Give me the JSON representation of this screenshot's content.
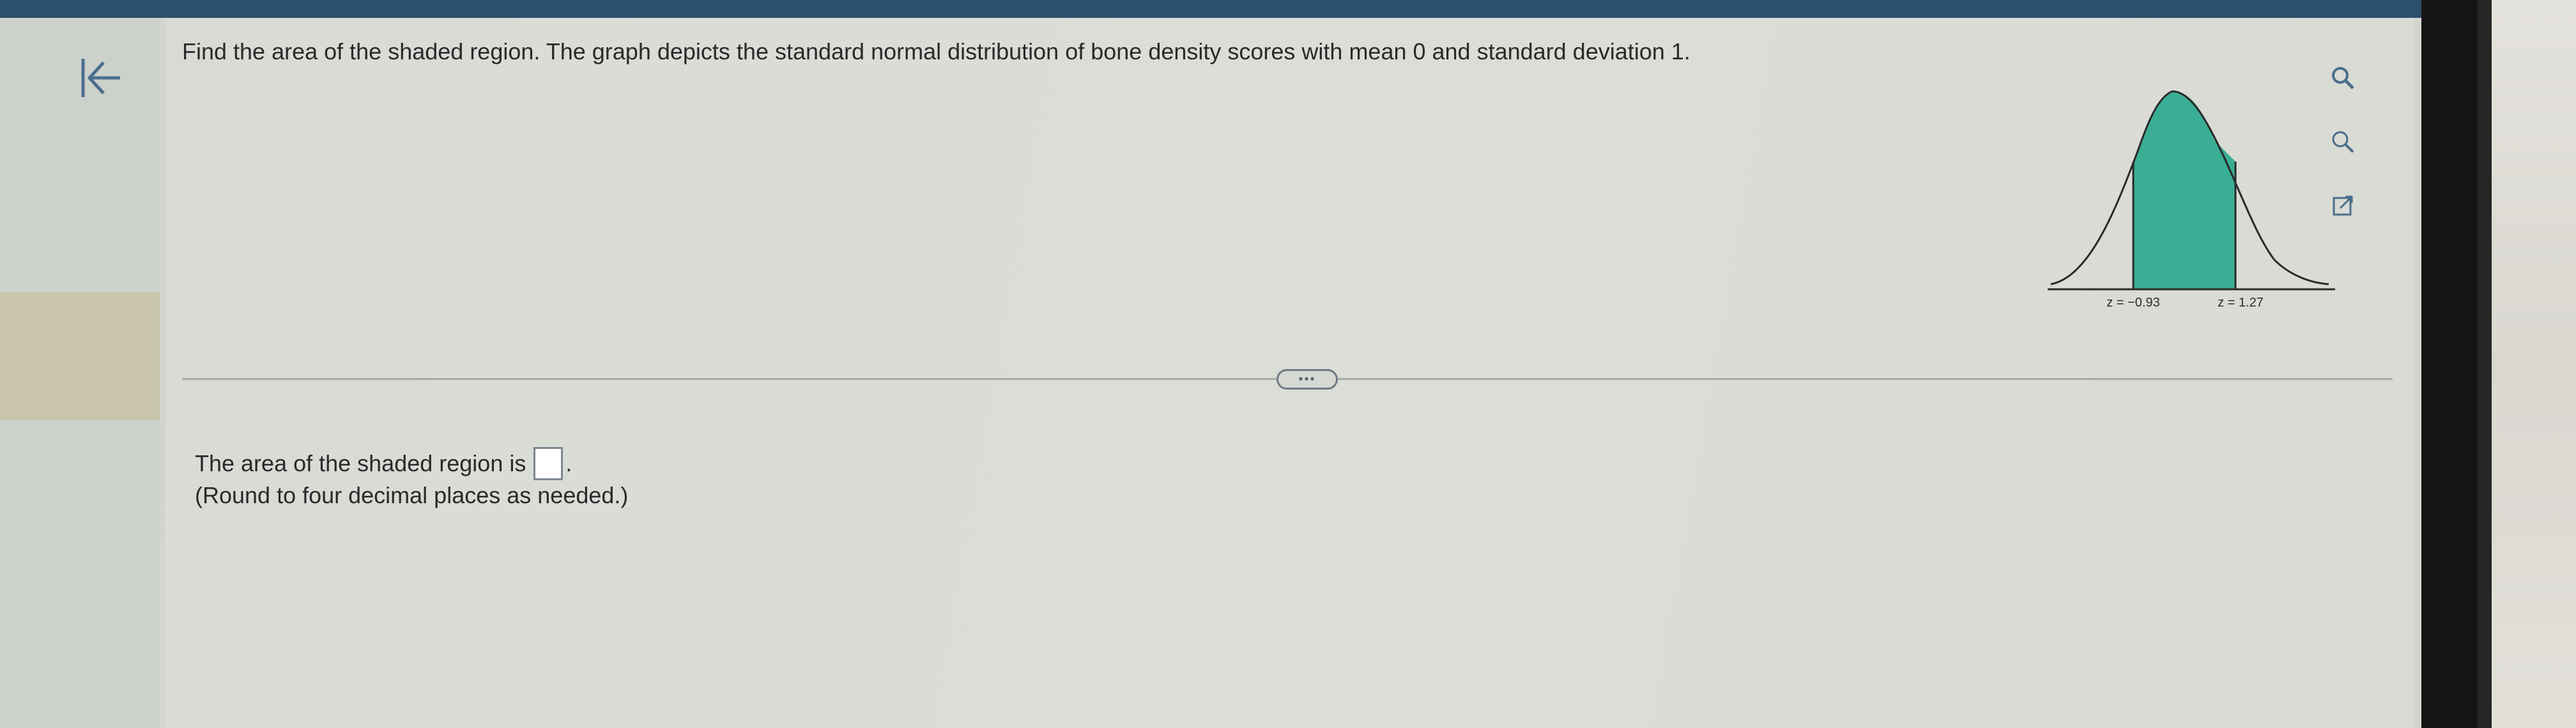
{
  "question": {
    "prompt": "Find the area of the shaded region. The graph depicts the standard normal distribution of bone density scores with mean 0 and standard deviation 1."
  },
  "graph": {
    "left_label": "z = −0.93",
    "right_label": "z = 1.27",
    "shade_color": "#3aae95"
  },
  "answer": {
    "prefix": "The area of the shaded region is",
    "suffix": ".",
    "note": "(Round to four decimal places as needed.)"
  },
  "controls": {
    "expand_handle": "•••",
    "icons": [
      "back-to-start-icon",
      "zoom-in-icon",
      "zoom-out-icon",
      "popout-icon"
    ]
  },
  "colors": {
    "topbar": "#2c4f6c",
    "accent_icon": "#4b6e8c"
  }
}
